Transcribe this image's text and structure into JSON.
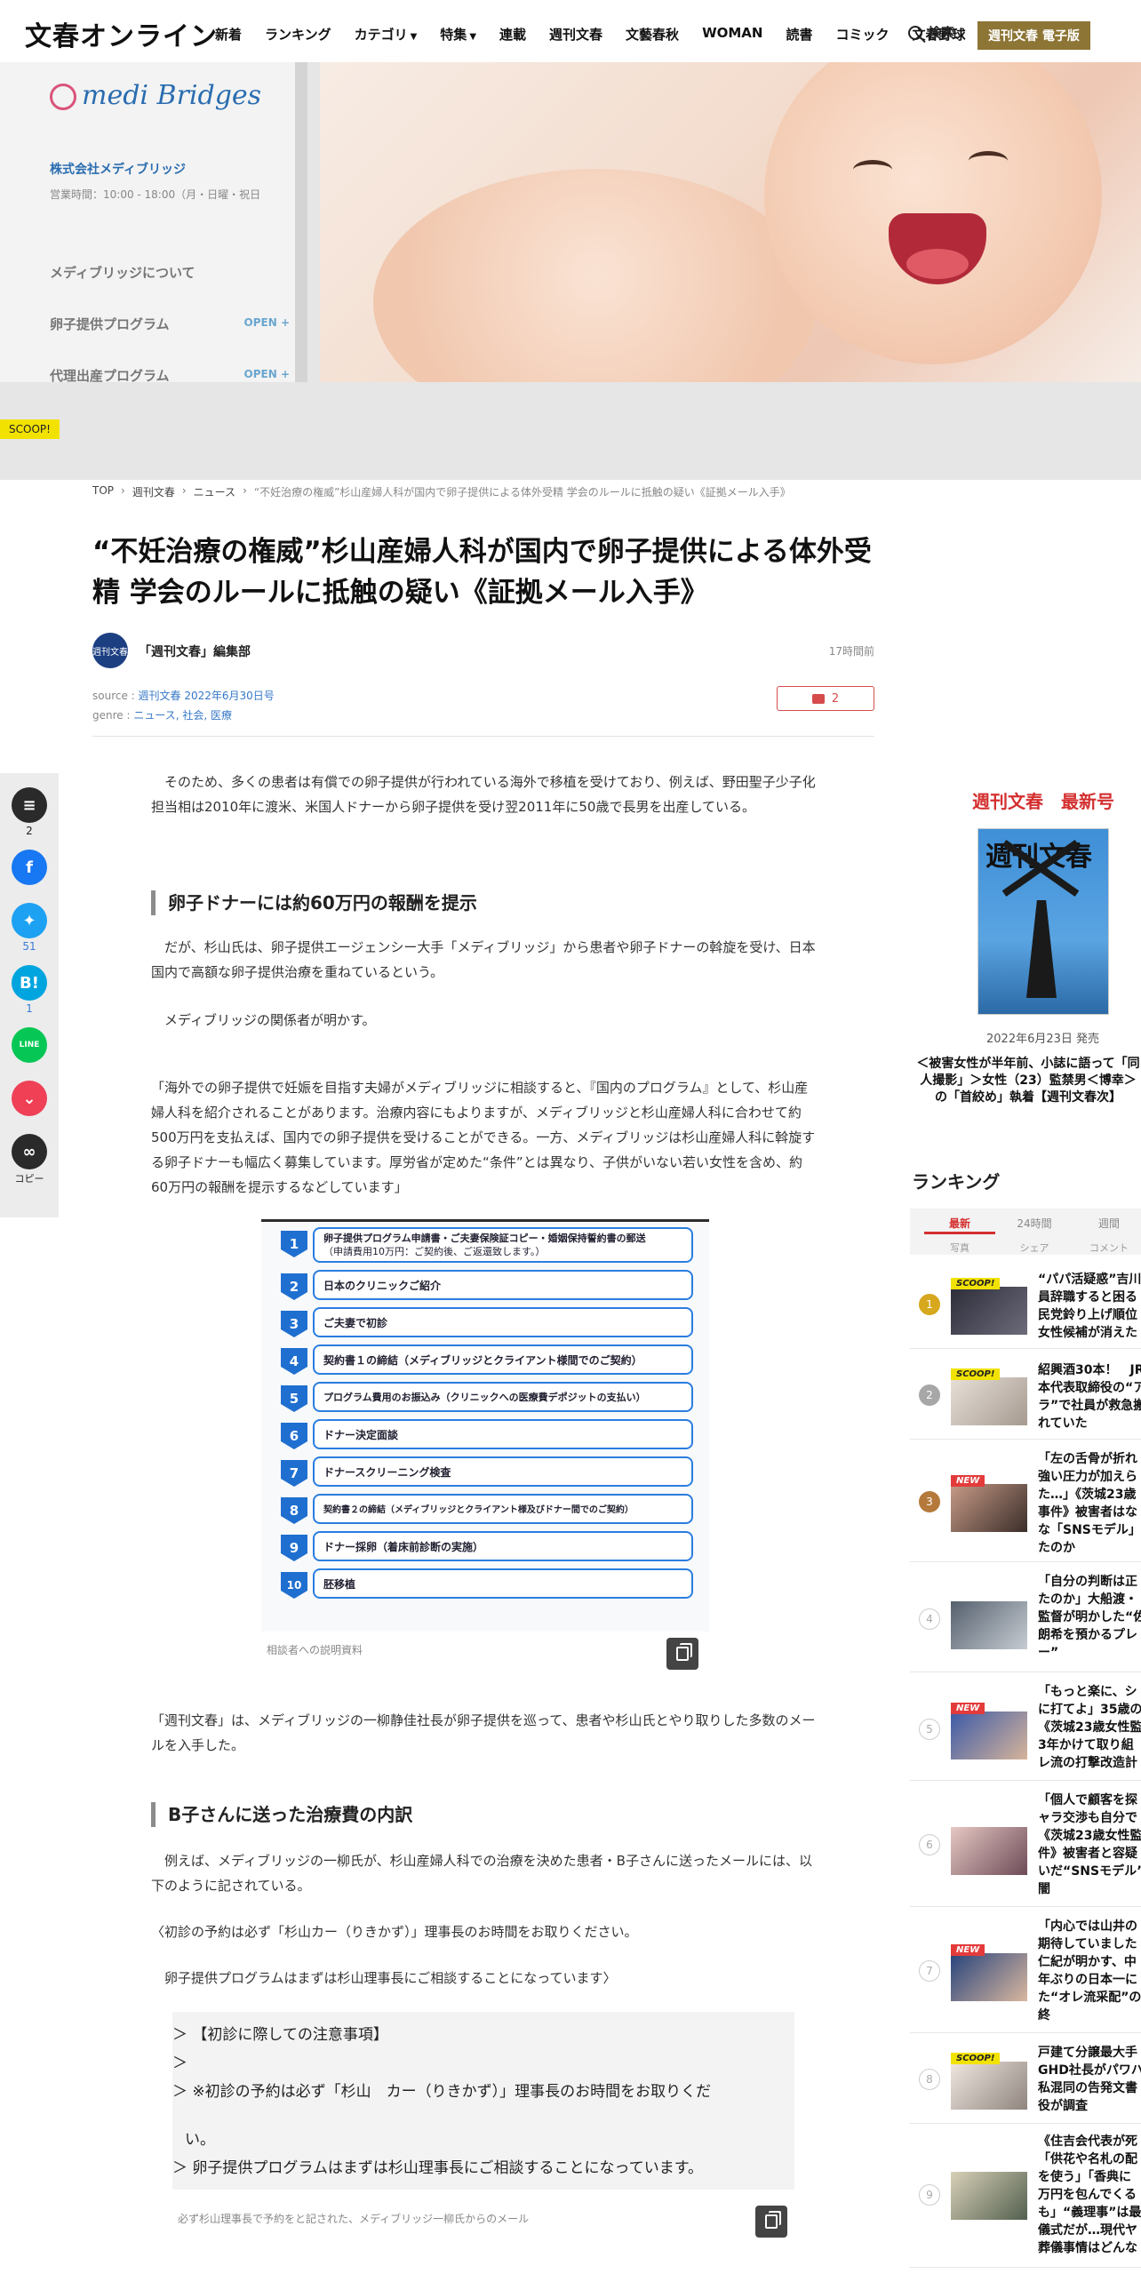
{
  "header": {
    "logo": "文春オンライン",
    "nav": [
      "新着",
      "ランキング",
      "カテゴリ",
      "特集",
      "連載",
      "週刊文春",
      "文藝春秋",
      "WOMAN",
      "読書",
      "コミック",
      "文春野球"
    ],
    "search_label": "検索",
    "edition_button": "週刊文春 電子版"
  },
  "hero": {
    "brand": "medi Bridges",
    "company": "株式会社メディブリッジ",
    "hours": "営業時間：10:00 - 18:00（月・日曜・祝日",
    "menu": [
      "メディブリッジについて",
      "卵子提供プログラム",
      "代理出産プログラム"
    ],
    "open_label": "OPEN +",
    "scoop_badge": "SCOOP!"
  },
  "breadcrumb": [
    "TOP",
    "週刊文春",
    "ニュース",
    "“不妊治療の権威”杉山産婦人科が国内で卵子提供による体外受精 学会のルールに抵触の疑い《証拠メール入手》"
  ],
  "article": {
    "title": "“不妊治療の権威”杉山産婦人科が国内で卵子提供による体外受精 学会のルールに抵触の疑い《証拠メール入手》",
    "author_avatar": "週刊文春",
    "author": "「週刊文春」編集部",
    "time_ago": "17時間前",
    "source_label": "source : ",
    "source_value": "週刊文春 2022年6月30日号",
    "genre_label": "genre : ",
    "genre_value": "ニュース, 社会, 医療",
    "comment_count": "2",
    "para1": "そのため、多くの患者は有償での卵子提供が行われている海外で移植を受けており、例えば、野田聖子少子化担当相は2010年に渡米、米国人ドナーから卵子提供を受け翌2011年に50歳で長男を出産している。",
    "h2_1": "卵子ドナーには約60万円の報酬を提示",
    "para2": "だが、杉山氏は、卵子提供エージェンシー大手「メディブリッジ」から患者や卵子ドナーの斡旋を受け、日本国内で高額な卵子提供治療を重ねているという。",
    "para3": "メディブリッジの関係者が明かす。",
    "para4": "「海外での卵子提供で妊娠を目指す夫婦がメディブリッジに相談すると、『国内のプログラム』として、杉山産婦人科を紹介されることがあります。治療内容にもよりますが、メディブリッジと杉山産婦人科に合わせて約500万円を支払えば、国内での卵子提供を受けることができる。一方、メディブリッジは杉山産婦人科に斡旋する卵子ドナーも幅広く募集しています。厚労省が定めた“条件”とは異なり、子供がいない若い女性を含め、約60万円の報酬を提示するなどしています」",
    "figure_steps": [
      "卵子提供プログラム申請書・ご夫妻保険証コピー・婚姻保持誓約書の郵送",
      "日本のクリニックご紹介",
      "ご夫妻で初診",
      "契約書１の締結（メディブリッジとクライアント様間でのご契約）",
      "プログラム費用のお振込み（クリニックへの医療費デポジットの支払い）",
      "ドナー決定面談",
      "ドナースクリーニング検査",
      "契約書２の締結（メディブリッジとクライアント様及びドナー間でのご契約）",
      "ドナー採卵（着床前診断の実施）",
      "胚移植"
    ],
    "figure_step1_sub": "（申請費用10万円：ご契約後、ご返還致します。）",
    "figure_caption": "相談者への説明資料",
    "para5": "「週刊文春」は、メディブリッジの一柳静佳社長が卵子提供を巡って、患者や杉山氏とやり取りした多数のメールを入手した。",
    "h2_2": "B子さんに送った治療費の内訳",
    "para6": "例えば、メディブリッジの一柳氏が、杉山産婦人科での治療を決めた患者・B子さんに送ったメールには、以下のように記されている。",
    "para7": "〈初診の予約は必ず「杉山カー（りきかず）」理事長のお時間をお取りください。",
    "para8": "卵子提供プログラムはまずは杉山理事長にご相談することになっています〉",
    "quote_lines": [
      "＞ 【初診に際しての注意事項】",
      "＞",
      "＞ ※初診の予約は必ず「杉山　カー（りきかず）」理事長のお時間をお取りくだ",
      "い。",
      "＞ 卵子提供プログラムはまずは杉山理事長にご相談することになっています。"
    ],
    "quote_caption": "必ず杉山理事長で予約をと記された、メディブリッジ一柳氏からのメール"
  },
  "sharebar": {
    "comment_count": "2",
    "twitter_count": "51",
    "hatena_count": "1",
    "line_label": "LINE",
    "copy_label": "コピー"
  },
  "sidebar": {
    "latest_title": "週刊文春　最新号",
    "magazine_logo": "週刊文春",
    "release_date": "2022年6月23日 発売",
    "issue_desc": "＜被害女性が半年前、小誌に語って「同人撮影」＞女性（23）監禁男＜博幸＞の「首絞め」執着【週刊文春次】",
    "ranking_title": "ランキング",
    "tabs": [
      "最新",
      "24時間",
      "週間"
    ],
    "subtabs": [
      "写真",
      "シェア",
      "コメント"
    ],
    "items": [
      {
        "num": "1",
        "badge": "SCOOP!",
        "lines": [
          "“パパ活疑惑”吉川",
          "員辞職すると困る",
          "民党鈴り上げ順位",
          "女性候補が消えた"
        ]
      },
      {
        "num": "2",
        "badge": "SCOOP!",
        "lines": [
          "紹興酒30本！　JR",
          "本代表取締役の“ア",
          "ラ”で社員が救急搬",
          "れていた"
        ]
      },
      {
        "num": "3",
        "badge": "NEW",
        "lines": [
          "「左の舌骨が折れ",
          "強い圧力が加えら",
          "た…」《茨城23歳",
          "事件》被害者はな",
          "な「SNSモデル」",
          "たのか"
        ]
      },
      {
        "num": "4",
        "badge": "",
        "lines": [
          "「自分の判断は正",
          "たのか」大船渡・",
          "監督が明かした“佐",
          "朗希を預かるプレ",
          "ー”"
        ]
      },
      {
        "num": "5",
        "badge": "NEW",
        "lines": [
          "「もっと楽に、シ",
          "に打てよ」35歳の",
          "《茨城23歳女性監",
          "3年かけて取り組",
          "レ流の打撃改造計"
        ]
      },
      {
        "num": "6",
        "badge": "",
        "lines": [
          "「個人で顧客を探",
          "ャラ交渉も自分で",
          "《茨城23歳女性監",
          "件》被害者と容疑",
          "いだ“SNSモデル”",
          "闇"
        ]
      },
      {
        "num": "7",
        "badge": "NEW",
        "lines": [
          "「内心では山井の",
          "期待していました",
          "仁紀が明かす、中",
          "年ぶりの日本一に",
          "た“オレ流采配”の",
          "終"
        ]
      },
      {
        "num": "8",
        "badge": "SCOOP!",
        "lines": [
          "戸建て分譲最大手",
          "GHD社長がパワハ",
          "私混同の告発文書",
          "役が調査"
        ]
      },
      {
        "num": "9",
        "badge": "",
        "lines": [
          "《住吉会代表が死",
          "「供花や名札の配",
          "を使う」「香典に",
          "万円を包んでくる",
          "も」“義理事”は最",
          "儀式だが…現代ヤ",
          "葬儀事情はどんな"
        ]
      }
    ]
  },
  "colors": {
    "accent_red": "#d42f2f",
    "edition_gold": "#8d7535",
    "facebook": "#1877f2",
    "twitter": "#1da1f2",
    "hatena": "#00a4de",
    "line": "#06c755",
    "pocket": "#ef4056"
  }
}
